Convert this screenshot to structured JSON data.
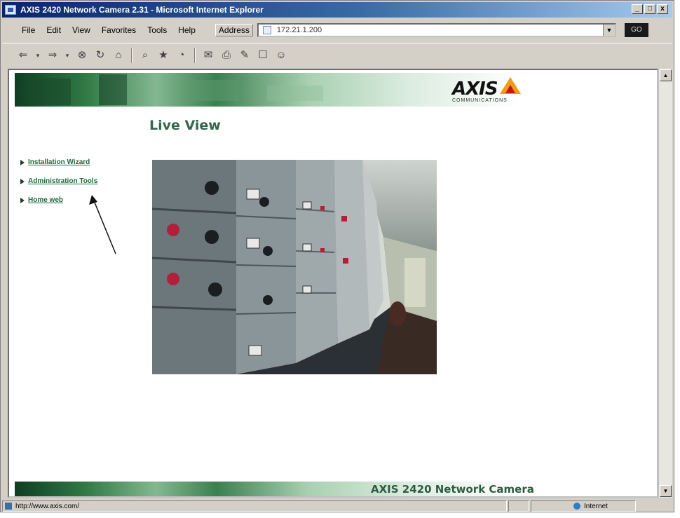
{
  "window": {
    "title": "AXIS 2420 Network Camera 2.31 - Microsoft Internet Explorer",
    "controls": {
      "minimize": "_",
      "maximize": "□",
      "close": "x"
    }
  },
  "menu": {
    "items": [
      "File",
      "Edit",
      "View",
      "Favorites",
      "Tools",
      "Help"
    ],
    "address_label": "Address",
    "address_value": "172.21.1.200",
    "go_label": "GO"
  },
  "toolbar": {
    "icons": [
      "back-icon",
      "dropdown-icon",
      "forward-icon",
      "dropdown-icon",
      "stop-icon",
      "refresh-icon",
      "home-icon",
      "search-icon",
      "favorites-icon",
      "history-icon",
      "mail-icon",
      "print-icon",
      "edit-icon",
      "discuss-icon",
      "messenger-icon"
    ]
  },
  "page": {
    "brand": "AXIS",
    "brand_sub": "COMMUNICATIONS",
    "title": "Live View",
    "links": [
      {
        "label": "Installation Wizard"
      },
      {
        "label": "Administration Tools"
      },
      {
        "label": "Home web"
      }
    ],
    "footer": "AXIS 2420 Network Camera"
  },
  "status": {
    "url": "http://www.axis.com/",
    "zone": "Internet"
  },
  "colors": {
    "title_green": "#33664a",
    "link_green": "#1f6a3c",
    "titlebar_blue": "#0a246a"
  }
}
